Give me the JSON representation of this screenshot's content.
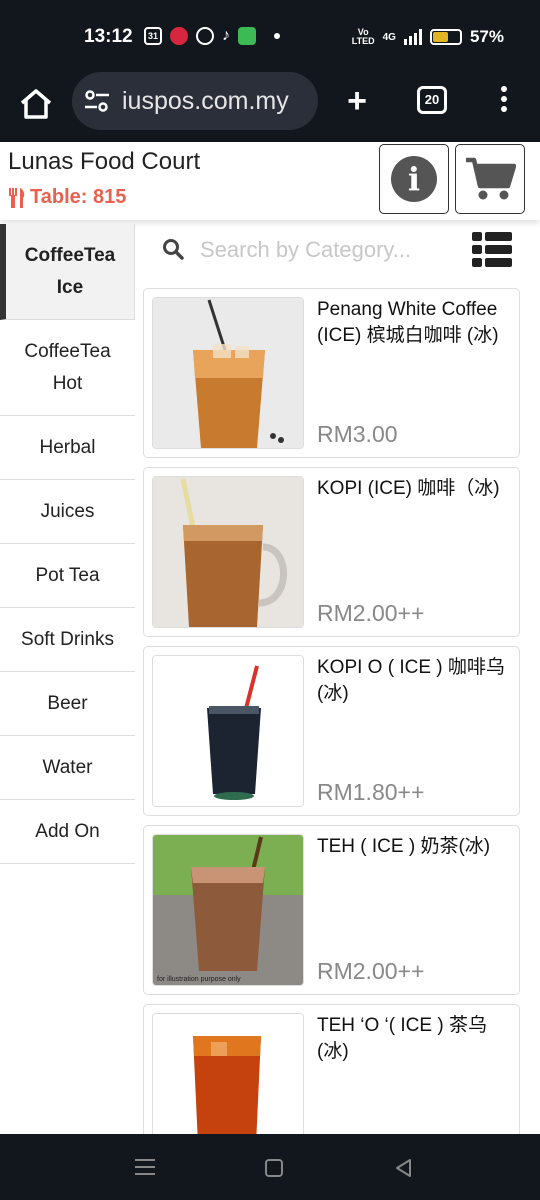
{
  "status_bar": {
    "time": "13:12",
    "calendar_badge": "31",
    "network_top": "Vo",
    "network_bottom": "LTED",
    "network_type": "4G",
    "battery": "57%"
  },
  "browser": {
    "url": "iuspos.com.my",
    "tab_count": "20"
  },
  "header": {
    "restaurant_name": "Lunas Food Court",
    "table_label": "Table: 815"
  },
  "search": {
    "placeholder": "Search by Category..."
  },
  "categories": [
    {
      "label": "CoffeeTea Ice",
      "active": true
    },
    {
      "label": "CoffeeTea Hot",
      "active": false
    },
    {
      "label": "Herbal",
      "active": false
    },
    {
      "label": "Juices",
      "active": false
    },
    {
      "label": "Pot Tea",
      "active": false
    },
    {
      "label": "Soft Drinks",
      "active": false
    },
    {
      "label": "Beer",
      "active": false
    },
    {
      "label": "Water",
      "active": false
    },
    {
      "label": "Add On",
      "active": false
    }
  ],
  "products": [
    {
      "name": "Penang White Coffee (ICE) 槟城白咖啡 (冰)",
      "price": "RM3.00"
    },
    {
      "name": "KOPI (ICE) 咖啡（冰)",
      "price": "RM2.00++"
    },
    {
      "name": "KOPI O ( ICE ) 咖啡乌(冰)",
      "price": "RM1.80++"
    },
    {
      "name": "TEH ( ICE ) 奶茶(冰)",
      "price": "RM2.00++",
      "caption": "for illustration purpose only"
    },
    {
      "name": "TEH ‘O ‘( ICE ) 茶乌(冰)",
      "price": ""
    }
  ],
  "colors": {
    "accent": "#e8614f",
    "dark_bar": "#12161d"
  }
}
